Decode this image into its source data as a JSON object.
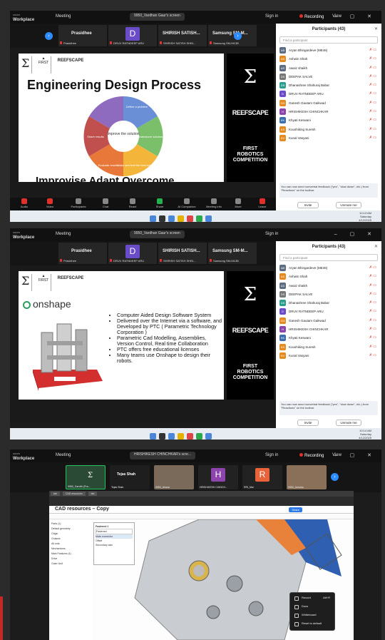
{
  "app": {
    "brand": "zoom",
    "product": "Workplace",
    "meeting_label": "Meeting",
    "sign_in": "Sign in",
    "recording": "Recording",
    "view": "View",
    "window_controls": "– ▢ ✕"
  },
  "shot1": {
    "share_pill": "9950_Vardhan Gaur's screen",
    "tiles": [
      {
        "name": "Prasidhee",
        "label": "Prasidhee",
        "avatar": ""
      },
      {
        "name": "",
        "label": "DRUV RATNDEEP ARU",
        "avatar": "D"
      },
      {
        "name": "SHIRISH SATISH...",
        "label": "SHIRISH SATISH SHIN...",
        "avatar": ""
      },
      {
        "name": "Samsung SM-M...",
        "label": "Samsung SM-M13B",
        "avatar": ""
      }
    ],
    "slide_title": "Engineering Design Process",
    "slide_foot": "Improvise Adapt Overcome",
    "cycle_steps": [
      "Define a problem",
      "Identify what's needed to solve the problem",
      "Brainstorm solutions",
      "Make and test the best solution",
      "Evaluate results",
      "Share results"
    ],
    "cycle_center": "Improve the solution",
    "controls": [
      "Audio",
      "Video",
      "Participants",
      "Chat",
      "React",
      "Share",
      "AI Companion",
      "Meeting info",
      "More",
      "Leave"
    ],
    "participants_count_label": "43",
    "clock_time": "10:13 AM",
    "clock_day": "Saturday",
    "clock_date": "4/12/2025"
  },
  "shot2": {
    "share_pill": "9950_Vardhan Gaur's screen",
    "tiles": [
      {
        "name": "Prasidhee",
        "label": "Prasidhee",
        "avatar": ""
      },
      {
        "name": "",
        "label": "DRUV RATNDEEP ARU",
        "avatar": "D"
      },
      {
        "name": "SHIRISH SATISH...",
        "label": "SHIRISH SATISH SHIN...",
        "avatar": ""
      },
      {
        "name": "Samsung SM-M...",
        "label": "Samsung SM-M13B",
        "avatar": ""
      }
    ],
    "onshape_logo": "onshape",
    "bullets": [
      "Computer Aided Design Software System",
      "Delivered over the Internet via a software, and Developed by PTC ( Parametric Technology Corporation )",
      "Parametric Cad Modelling, Assemblies, Version Control, Real time Collaboration",
      "PTC offers free educational licenses",
      "Many teams use Onshape to design their robots."
    ],
    "clock_time": "10:14 AM",
    "clock_day": "Saturday",
    "clock_date": "4/12/2025"
  },
  "shot3": {
    "share_pill": "HRISHIKESH CHINCHKAR's scre...",
    "tiles": [
      {
        "name": "",
        "label": "9950_Garvith (Pra...",
        "avatar": ""
      },
      {
        "name": "Tejas Shah",
        "label": "Tejas Shah",
        "avatar": ""
      },
      {
        "name": "",
        "label": "9950_Ahana",
        "avatar": ""
      },
      {
        "name": "",
        "label": "HRISHIKESH CHINCH...",
        "avatar": "H"
      },
      {
        "name": "",
        "label": "RRI_Mai",
        "avatar": "R"
      },
      {
        "name": "",
        "label": "9950_Ansaha",
        "avatar": ""
      }
    ],
    "doc_title": "CAD resources – Copy",
    "share_button": "Share",
    "tree_items": [
      "Parts (1)",
      "Default geometry",
      "Origin",
      "Chassis",
      "All rods",
      "Mechanisms",
      "Main Features (4)",
      "Drive",
      "Outer Unit"
    ],
    "feature_panel": [
      "Fastened 1",
      "Fastened",
      "Mate connector",
      "Offset",
      "Secondary axis"
    ],
    "menu_items": [
      "Record",
      "Docs",
      "Whiteboard",
      "Reset to default"
    ],
    "menu_shortcut": "Alt+R"
  },
  "panel": {
    "title": "Participants (43)",
    "search_placeholder": "Find a participant",
    "participants": [
      {
        "initials": "AB",
        "name": "Aryan Bhingardeve (ME46)",
        "color": "#5b6c83"
      },
      {
        "initials": "AS",
        "name": "Ashwin Shah",
        "color": "#e58a1f"
      },
      {
        "initials": "AS",
        "name": "Awaiz shaikh",
        "color": "#5b6c83"
      },
      {
        "initials": "DS",
        "name": "DEEPAK SALVE",
        "color": "#777777"
      },
      {
        "initials": "DS",
        "name": "Dhanashree Shahuraj Babar",
        "color": "#2a9d8f"
      },
      {
        "initials": "D",
        "name": "DRUV RATNDEEP ARU",
        "color": "#6a4cc9"
      },
      {
        "initials": "GG",
        "name": "Ganesh Gautam Gaikwad",
        "color": "#e58a1f"
      },
      {
        "initials": "H",
        "name": "HRISHIKESH CHINCHKAR",
        "color": "#8e44ad"
      },
      {
        "initials": "KK",
        "name": "Khyati Keswani",
        "color": "#3c6fb0"
      },
      {
        "initials": "KS",
        "name": "Koushiking Suresh",
        "color": "#e58a1f"
      },
      {
        "initials": "KV",
        "name": "Kunal Vasyani",
        "color": "#e58a1f"
      }
    ],
    "note": "You can now send nonverbal feedback (\"yes\", \"slow down\", etc.) from \"Reactions\" on the toolbar.",
    "invite": "Invite",
    "unmute_me": "Unmute me"
  },
  "colors": {
    "zoom_blue": "#2d8cff",
    "record_red": "#e0302a",
    "share_green": "#22b14c"
  }
}
